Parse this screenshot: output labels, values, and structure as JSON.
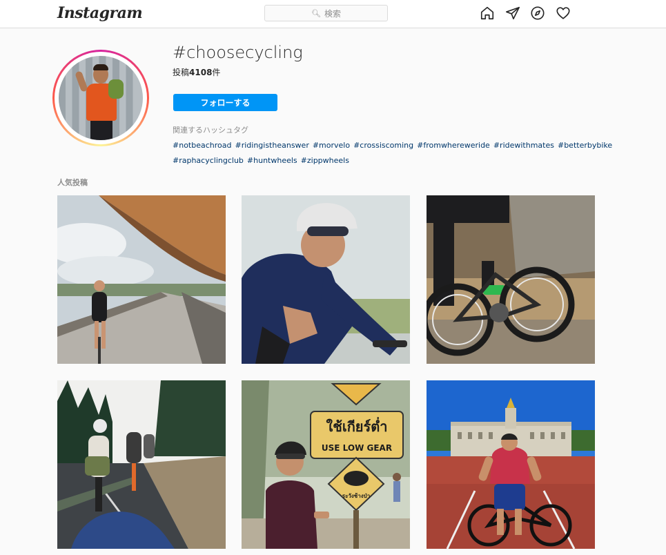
{
  "nav": {
    "logo": "Instagram",
    "search_placeholder": "検索",
    "icons": [
      "home-icon",
      "direct-icon",
      "explore-icon",
      "activity-heart-icon"
    ]
  },
  "header": {
    "hashtag": "#choosecycling",
    "post_count_prefix": "投稿",
    "post_count": "4108",
    "post_count_suffix": "件",
    "follow_label": "フォローする",
    "related_label": "関連するハッシュタグ",
    "related_tags": [
      "#notbeachroad",
      "#ridingistheanswer",
      "#morvelo",
      "#crossiscoming",
      "#fromwhereweride",
      "#ridewithmates",
      "#betterbybike",
      "#raphacyclingclub",
      "#huntwheels",
      "#zippwheels"
    ]
  },
  "main": {
    "top_posts_label": "人気投稿",
    "posts": [
      {
        "alt": "velodrome-rider"
      },
      {
        "alt": "wahoo-cyclist"
      },
      {
        "alt": "road-bike-closeup"
      },
      {
        "alt": "forest-road-riders"
      },
      {
        "alt": "thai-sign-rider",
        "sign_thai": "ใช้เกียร์ต่ำ",
        "sign_english": "USE LOW GEAR",
        "sign_small": "ระวังช้างป่า"
      },
      {
        "alt": "buckingham-palace-rider"
      }
    ]
  },
  "colors": {
    "follow_button": "#0095f6",
    "hashtag_link": "#00376b",
    "muted_text": "#8e8e8e"
  }
}
